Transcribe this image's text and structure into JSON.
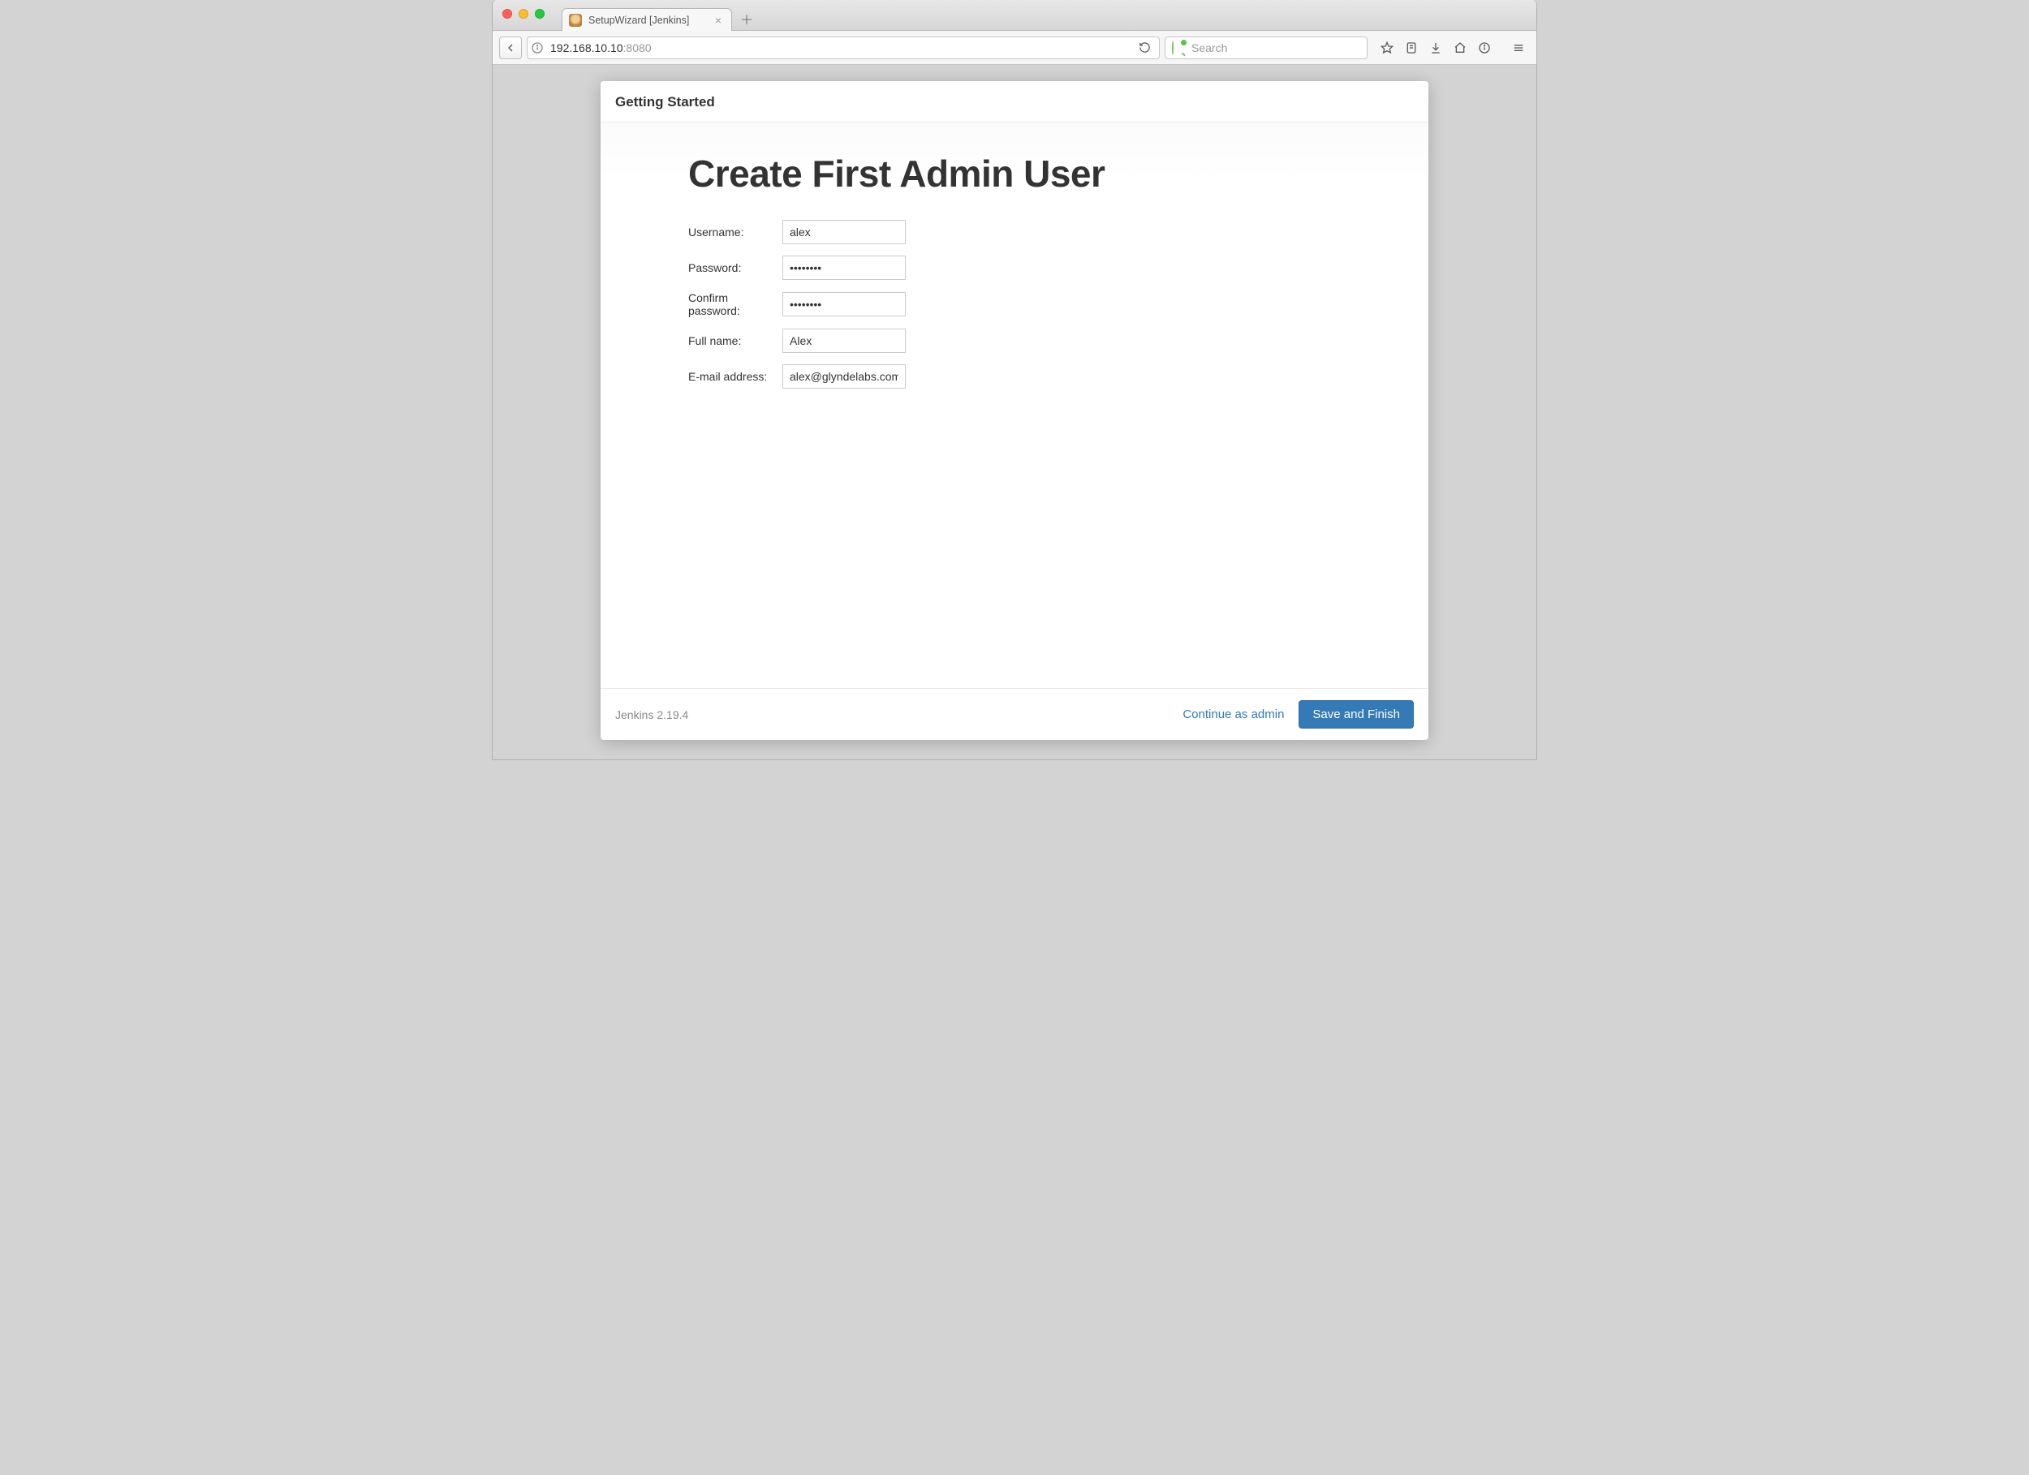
{
  "browser": {
    "tab_title": "SetupWizard [Jenkins]",
    "url_host": "192.168.10.10",
    "url_port": ":8080",
    "search_placeholder": "Search"
  },
  "modal": {
    "header": "Getting Started",
    "title": "Create First Admin User",
    "form": {
      "username_label": "Username:",
      "username_value": "alex",
      "password_label": "Password:",
      "password_value": "••••••••",
      "confirm_label": "Confirm password:",
      "confirm_value": "••••••••",
      "fullname_label": "Full name:",
      "fullname_value": "Alex",
      "email_label": "E-mail address:",
      "email_value": "alex@glyndelabs.com"
    },
    "footer": {
      "version": "Jenkins 2.19.4",
      "continue_label": "Continue as admin",
      "save_label": "Save and Finish"
    }
  }
}
